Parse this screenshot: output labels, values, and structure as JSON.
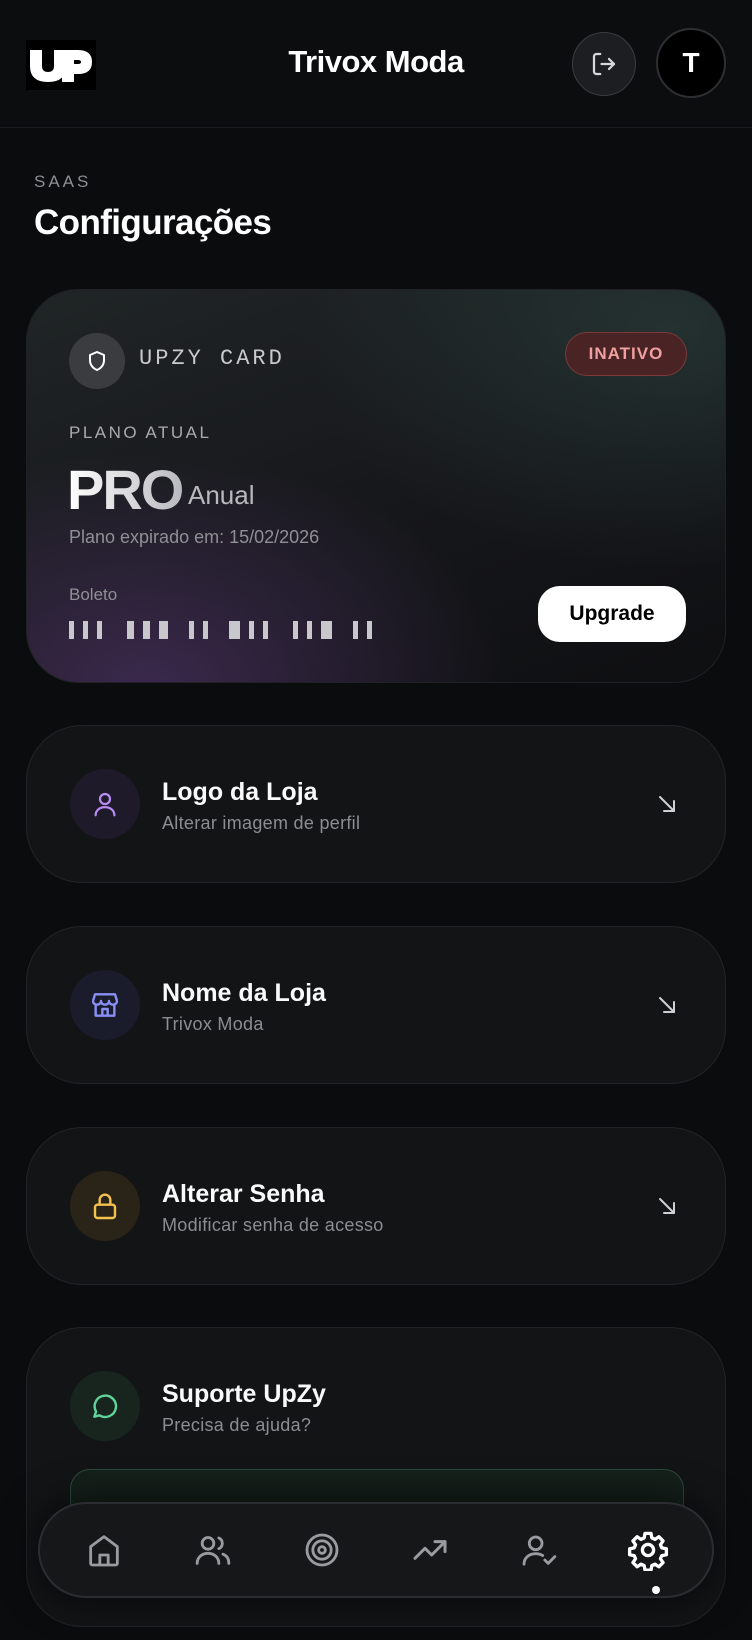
{
  "header": {
    "title": "Trivox Moda",
    "avatar_initial": "T",
    "logo_text": "UP"
  },
  "page": {
    "eyebrow": "SAAS",
    "title": "Configurações"
  },
  "plan_card": {
    "brand": "UPZY CARD",
    "status": "INATIVO",
    "plan_label": "PLANO ATUAL",
    "plan_name": "PRO",
    "plan_cycle": "Anual",
    "expiry_text": "Plano expirado em: 15/02/2026",
    "payment_method": "Boleto",
    "upgrade_label": "Upgrade"
  },
  "settings": [
    {
      "title": "Logo da Loja",
      "subtitle": "Alterar imagem de perfil",
      "icon": "user-icon",
      "color": "#b68cf0"
    },
    {
      "title": "Nome da Loja",
      "subtitle": "Trivox Moda",
      "icon": "store-icon",
      "color": "#8a8ff5"
    },
    {
      "title": "Alterar Senha",
      "subtitle": "Modificar senha de acesso",
      "icon": "lock-icon",
      "color": "#f2c14e"
    }
  ],
  "support": {
    "title": "Suporte UpZy",
    "subtitle": "Precisa de ajuda?",
    "icon": "chat-bubble-icon",
    "color": "#5fd39a"
  },
  "nav": {
    "items": [
      "home-icon",
      "users-icon",
      "target-icon",
      "trending-up-icon",
      "user-check-icon",
      "gear-icon"
    ],
    "active": "gear-icon"
  },
  "colors": {
    "background": "#0b0c0e",
    "status_inactive": "#f0a0a0",
    "accent_green": "#5fd39a"
  }
}
